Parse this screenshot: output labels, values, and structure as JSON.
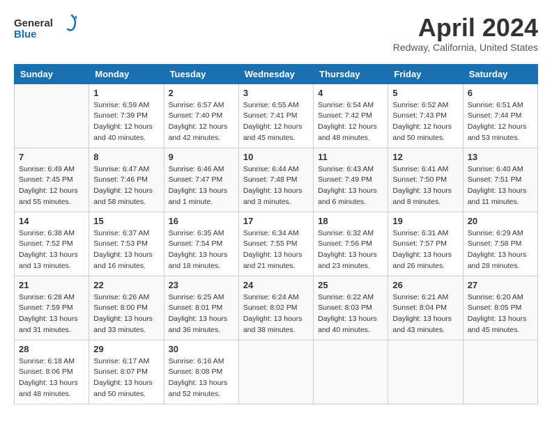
{
  "header": {
    "logo_general": "General",
    "logo_blue": "Blue",
    "title": "April 2024",
    "subtitle": "Redway, California, United States"
  },
  "days_of_week": [
    "Sunday",
    "Monday",
    "Tuesday",
    "Wednesday",
    "Thursday",
    "Friday",
    "Saturday"
  ],
  "weeks": [
    [
      {
        "day": "",
        "sunrise": "",
        "sunset": "",
        "daylight": ""
      },
      {
        "day": "1",
        "sunrise": "Sunrise: 6:59 AM",
        "sunset": "Sunset: 7:39 PM",
        "daylight": "Daylight: 12 hours and 40 minutes."
      },
      {
        "day": "2",
        "sunrise": "Sunrise: 6:57 AM",
        "sunset": "Sunset: 7:40 PM",
        "daylight": "Daylight: 12 hours and 42 minutes."
      },
      {
        "day": "3",
        "sunrise": "Sunrise: 6:55 AM",
        "sunset": "Sunset: 7:41 PM",
        "daylight": "Daylight: 12 hours and 45 minutes."
      },
      {
        "day": "4",
        "sunrise": "Sunrise: 6:54 AM",
        "sunset": "Sunset: 7:42 PM",
        "daylight": "Daylight: 12 hours and 48 minutes."
      },
      {
        "day": "5",
        "sunrise": "Sunrise: 6:52 AM",
        "sunset": "Sunset: 7:43 PM",
        "daylight": "Daylight: 12 hours and 50 minutes."
      },
      {
        "day": "6",
        "sunrise": "Sunrise: 6:51 AM",
        "sunset": "Sunset: 7:44 PM",
        "daylight": "Daylight: 12 hours and 53 minutes."
      }
    ],
    [
      {
        "day": "7",
        "sunrise": "Sunrise: 6:49 AM",
        "sunset": "Sunset: 7:45 PM",
        "daylight": "Daylight: 12 hours and 55 minutes."
      },
      {
        "day": "8",
        "sunrise": "Sunrise: 6:47 AM",
        "sunset": "Sunset: 7:46 PM",
        "daylight": "Daylight: 12 hours and 58 minutes."
      },
      {
        "day": "9",
        "sunrise": "Sunrise: 6:46 AM",
        "sunset": "Sunset: 7:47 PM",
        "daylight": "Daylight: 13 hours and 1 minute."
      },
      {
        "day": "10",
        "sunrise": "Sunrise: 6:44 AM",
        "sunset": "Sunset: 7:48 PM",
        "daylight": "Daylight: 13 hours and 3 minutes."
      },
      {
        "day": "11",
        "sunrise": "Sunrise: 6:43 AM",
        "sunset": "Sunset: 7:49 PM",
        "daylight": "Daylight: 13 hours and 6 minutes."
      },
      {
        "day": "12",
        "sunrise": "Sunrise: 6:41 AM",
        "sunset": "Sunset: 7:50 PM",
        "daylight": "Daylight: 13 hours and 8 minutes."
      },
      {
        "day": "13",
        "sunrise": "Sunrise: 6:40 AM",
        "sunset": "Sunset: 7:51 PM",
        "daylight": "Daylight: 13 hours and 11 minutes."
      }
    ],
    [
      {
        "day": "14",
        "sunrise": "Sunrise: 6:38 AM",
        "sunset": "Sunset: 7:52 PM",
        "daylight": "Daylight: 13 hours and 13 minutes."
      },
      {
        "day": "15",
        "sunrise": "Sunrise: 6:37 AM",
        "sunset": "Sunset: 7:53 PM",
        "daylight": "Daylight: 13 hours and 16 minutes."
      },
      {
        "day": "16",
        "sunrise": "Sunrise: 6:35 AM",
        "sunset": "Sunset: 7:54 PM",
        "daylight": "Daylight: 13 hours and 18 minutes."
      },
      {
        "day": "17",
        "sunrise": "Sunrise: 6:34 AM",
        "sunset": "Sunset: 7:55 PM",
        "daylight": "Daylight: 13 hours and 21 minutes."
      },
      {
        "day": "18",
        "sunrise": "Sunrise: 6:32 AM",
        "sunset": "Sunset: 7:56 PM",
        "daylight": "Daylight: 13 hours and 23 minutes."
      },
      {
        "day": "19",
        "sunrise": "Sunrise: 6:31 AM",
        "sunset": "Sunset: 7:57 PM",
        "daylight": "Daylight: 13 hours and 26 minutes."
      },
      {
        "day": "20",
        "sunrise": "Sunrise: 6:29 AM",
        "sunset": "Sunset: 7:58 PM",
        "daylight": "Daylight: 13 hours and 28 minutes."
      }
    ],
    [
      {
        "day": "21",
        "sunrise": "Sunrise: 6:28 AM",
        "sunset": "Sunset: 7:59 PM",
        "daylight": "Daylight: 13 hours and 31 minutes."
      },
      {
        "day": "22",
        "sunrise": "Sunrise: 6:26 AM",
        "sunset": "Sunset: 8:00 PM",
        "daylight": "Daylight: 13 hours and 33 minutes."
      },
      {
        "day": "23",
        "sunrise": "Sunrise: 6:25 AM",
        "sunset": "Sunset: 8:01 PM",
        "daylight": "Daylight: 13 hours and 36 minutes."
      },
      {
        "day": "24",
        "sunrise": "Sunrise: 6:24 AM",
        "sunset": "Sunset: 8:02 PM",
        "daylight": "Daylight: 13 hours and 38 minutes."
      },
      {
        "day": "25",
        "sunrise": "Sunrise: 6:22 AM",
        "sunset": "Sunset: 8:03 PM",
        "daylight": "Daylight: 13 hours and 40 minutes."
      },
      {
        "day": "26",
        "sunrise": "Sunrise: 6:21 AM",
        "sunset": "Sunset: 8:04 PM",
        "daylight": "Daylight: 13 hours and 43 minutes."
      },
      {
        "day": "27",
        "sunrise": "Sunrise: 6:20 AM",
        "sunset": "Sunset: 8:05 PM",
        "daylight": "Daylight: 13 hours and 45 minutes."
      }
    ],
    [
      {
        "day": "28",
        "sunrise": "Sunrise: 6:18 AM",
        "sunset": "Sunset: 8:06 PM",
        "daylight": "Daylight: 13 hours and 48 minutes."
      },
      {
        "day": "29",
        "sunrise": "Sunrise: 6:17 AM",
        "sunset": "Sunset: 8:07 PM",
        "daylight": "Daylight: 13 hours and 50 minutes."
      },
      {
        "day": "30",
        "sunrise": "Sunrise: 6:16 AM",
        "sunset": "Sunset: 8:08 PM",
        "daylight": "Daylight: 13 hours and 52 minutes."
      },
      {
        "day": "",
        "sunrise": "",
        "sunset": "",
        "daylight": ""
      },
      {
        "day": "",
        "sunrise": "",
        "sunset": "",
        "daylight": ""
      },
      {
        "day": "",
        "sunrise": "",
        "sunset": "",
        "daylight": ""
      },
      {
        "day": "",
        "sunrise": "",
        "sunset": "",
        "daylight": ""
      }
    ]
  ]
}
